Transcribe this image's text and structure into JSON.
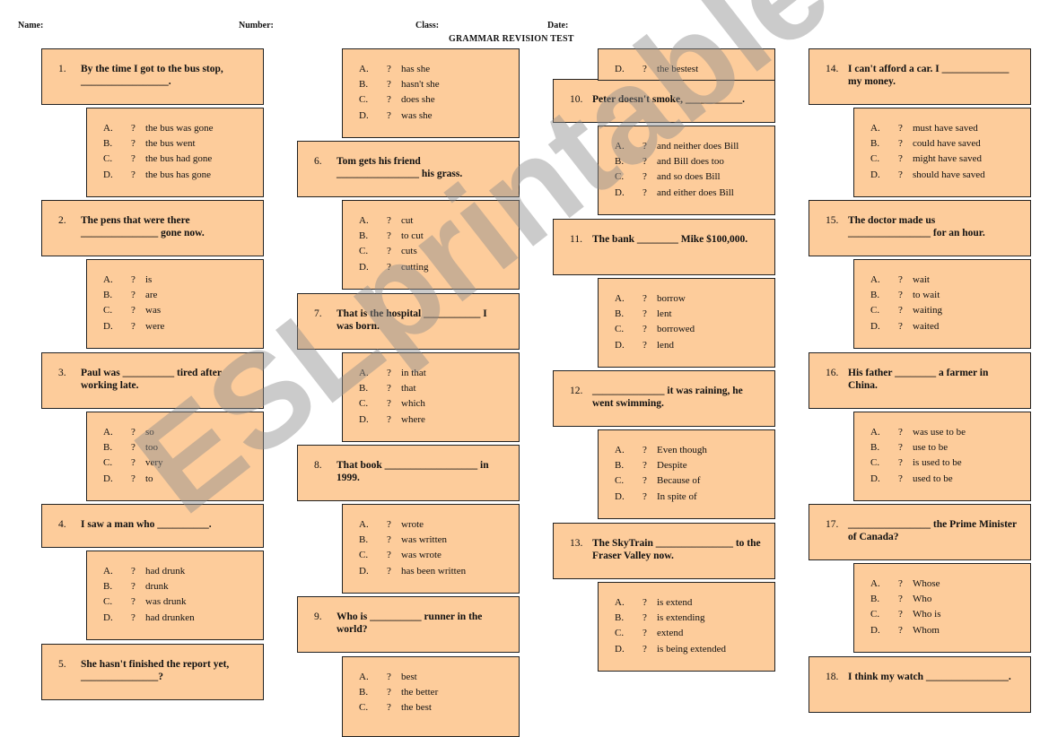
{
  "header": {
    "name_label": "Name:",
    "number_label": "Number:",
    "class_label": "Class:",
    "date_label": "Date:",
    "title": "GRAMMAR REVISION TEST"
  },
  "watermark": "ESLprintables.com",
  "questions": [
    {
      "num": "1.",
      "text": "By the time I got to the bus stop, _________________.",
      "options": [
        {
          "l": "A.",
          "t": "the bus was gone"
        },
        {
          "l": "B.",
          "t": "the bus went"
        },
        {
          "l": "C.",
          "t": "the bus had gone"
        },
        {
          "l": "D.",
          "t": "the bus has gone"
        }
      ]
    },
    {
      "num": "2.",
      "text": "The pens that were there _______________ gone now.",
      "options": [
        {
          "l": "A.",
          "t": "is"
        },
        {
          "l": "B.",
          "t": "are"
        },
        {
          "l": "C.",
          "t": "was"
        },
        {
          "l": "D.",
          "t": "were"
        }
      ]
    },
    {
      "num": "3.",
      "text": "Paul was __________ tired after working late.",
      "options": [
        {
          "l": "A.",
          "t": "so"
        },
        {
          "l": "B.",
          "t": "too"
        },
        {
          "l": "C.",
          "t": "very"
        },
        {
          "l": "D.",
          "t": "to"
        }
      ]
    },
    {
      "num": "4.",
      "text": "I saw a man who __________.",
      "options": [
        {
          "l": "A.",
          "t": "had drunk"
        },
        {
          "l": "B.",
          "t": "drunk"
        },
        {
          "l": "C.",
          "t": "was drunk"
        },
        {
          "l": "D.",
          "t": "had drunken"
        }
      ]
    },
    {
      "num": "5.",
      "text": "She hasn't finished the report yet, _______________?",
      "options": [
        {
          "l": "A.",
          "t": "has she"
        },
        {
          "l": "B.",
          "t": "hasn't she"
        },
        {
          "l": "C.",
          "t": "does she"
        },
        {
          "l": "D.",
          "t": "was she"
        }
      ]
    },
    {
      "num": "6.",
      "text": "Tom gets his friend ________________ his grass.",
      "options": [
        {
          "l": "A.",
          "t": "cut"
        },
        {
          "l": "B.",
          "t": "to cut"
        },
        {
          "l": "C.",
          "t": "cuts"
        },
        {
          "l": "D.",
          "t": "cutting"
        }
      ]
    },
    {
      "num": "7.",
      "text": "That is the hospital ___________ I was born.",
      "options": [
        {
          "l": "A.",
          "t": "in that"
        },
        {
          "l": "B.",
          "t": "that"
        },
        {
          "l": "C.",
          "t": "which"
        },
        {
          "l": "D.",
          "t": "where"
        }
      ]
    },
    {
      "num": "8.",
      "text": "That book __________________ in 1999.",
      "options": [
        {
          "l": "A.",
          "t": "wrote"
        },
        {
          "l": "B.",
          "t": "was written"
        },
        {
          "l": "C.",
          "t": "was wrote"
        },
        {
          "l": "D.",
          "t": "has been written"
        }
      ]
    },
    {
      "num": "9.",
      "text": "Who is __________ runner in the world?",
      "options": [
        {
          "l": "A.",
          "t": "best"
        },
        {
          "l": "B.",
          "t": "the better"
        },
        {
          "l": "C.",
          "t": "the best"
        },
        {
          "l": "D.",
          "t": "the bestest"
        }
      ]
    },
    {
      "num": "10.",
      "text": "Peter doesn't smoke, ___________.",
      "options": [
        {
          "l": "A.",
          "t": "and neither does Bill"
        },
        {
          "l": "B.",
          "t": "and Bill does too"
        },
        {
          "l": "C.",
          "t": "and so does Bill"
        },
        {
          "l": "D.",
          "t": "and either does Bill"
        }
      ]
    },
    {
      "num": "11.",
      "text": "The bank ________ Mike $100,000.",
      "options": [
        {
          "l": "A.",
          "t": "borrow"
        },
        {
          "l": "B.",
          "t": "lent"
        },
        {
          "l": "C.",
          "t": "borrowed"
        },
        {
          "l": "D.",
          "t": "lend"
        }
      ]
    },
    {
      "num": "12.",
      "text": "______________ it was raining, he went swimming.",
      "options": [
        {
          "l": "A.",
          "t": "Even though"
        },
        {
          "l": "B.",
          "t": "Despite"
        },
        {
          "l": "C.",
          "t": "Because of"
        },
        {
          "l": "D.",
          "t": "In spite of"
        }
      ]
    },
    {
      "num": "13.",
      "text": "The SkyTrain _______________ to the Fraser Valley now.",
      "options": [
        {
          "l": "A.",
          "t": "is extend"
        },
        {
          "l": "B.",
          "t": "is extending"
        },
        {
          "l": "C.",
          "t": "extend"
        },
        {
          "l": "D.",
          "t": "is being extended"
        }
      ]
    },
    {
      "num": "14.",
      "text": "I can't afford a car. I _____________ my money.",
      "options": [
        {
          "l": "A.",
          "t": "must have saved"
        },
        {
          "l": "B.",
          "t": "could have saved"
        },
        {
          "l": "C.",
          "t": "might have saved"
        },
        {
          "l": "D.",
          "t": "should have saved"
        }
      ]
    },
    {
      "num": "15.",
      "text": "The doctor made us ________________ for an hour.",
      "options": [
        {
          "l": "A.",
          "t": "wait"
        },
        {
          "l": "B.",
          "t": "to wait"
        },
        {
          "l": "C.",
          "t": "waiting"
        },
        {
          "l": "D.",
          "t": "waited"
        }
      ]
    },
    {
      "num": "16.",
      "text": "His father ________ a farmer in China.",
      "options": [
        {
          "l": "A.",
          "t": "was use to be"
        },
        {
          "l": "B.",
          "t": "use to be"
        },
        {
          "l": "C.",
          "t": "is used to be"
        },
        {
          "l": "D.",
          "t": "used to be"
        }
      ]
    },
    {
      "num": "17.",
      "text": "________________ the Prime Minister of Canada?",
      "options": [
        {
          "l": "A.",
          "t": "Whose"
        },
        {
          "l": "B.",
          "t": "Who"
        },
        {
          "l": "C.",
          "t": "Who is"
        },
        {
          "l": "D.",
          "t": "Whom"
        }
      ]
    },
    {
      "num": "18.",
      "text": "I think my watch ________________.",
      "options": []
    }
  ],
  "option_marker": "?"
}
